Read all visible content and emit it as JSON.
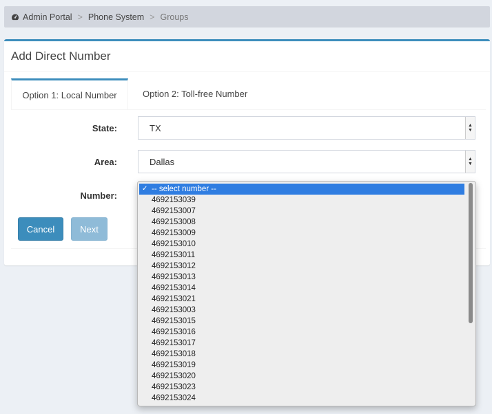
{
  "breadcrumb": {
    "items": [
      "Admin Portal",
      "Phone System",
      "Groups"
    ],
    "separator": ">"
  },
  "box": {
    "title": "Add Direct Number"
  },
  "tabs": [
    {
      "label": "Option 1: Local Number",
      "active": true
    },
    {
      "label": "Option 2: Toll-free Number",
      "active": false
    }
  ],
  "form": {
    "state_label": "State:",
    "state_value": "TX",
    "area_label": "Area:",
    "area_value": "Dallas",
    "number_label": "Number:"
  },
  "buttons": {
    "cancel": "Cancel",
    "next": "Next"
  },
  "dropdown": {
    "selected": "-- select number --",
    "options": [
      "4692153039",
      "4692153007",
      "4692153008",
      "4692153009",
      "4692153010",
      "4692153011",
      "4692153012",
      "4692153013",
      "4692153014",
      "4692153021",
      "4692153003",
      "4692153015",
      "4692153016",
      "4692153017",
      "4692153018",
      "4692153019",
      "4692153020",
      "4692153023",
      "4692153024"
    ]
  },
  "colors": {
    "accent": "#3c8dbc",
    "highlight": "#2f7de1"
  }
}
